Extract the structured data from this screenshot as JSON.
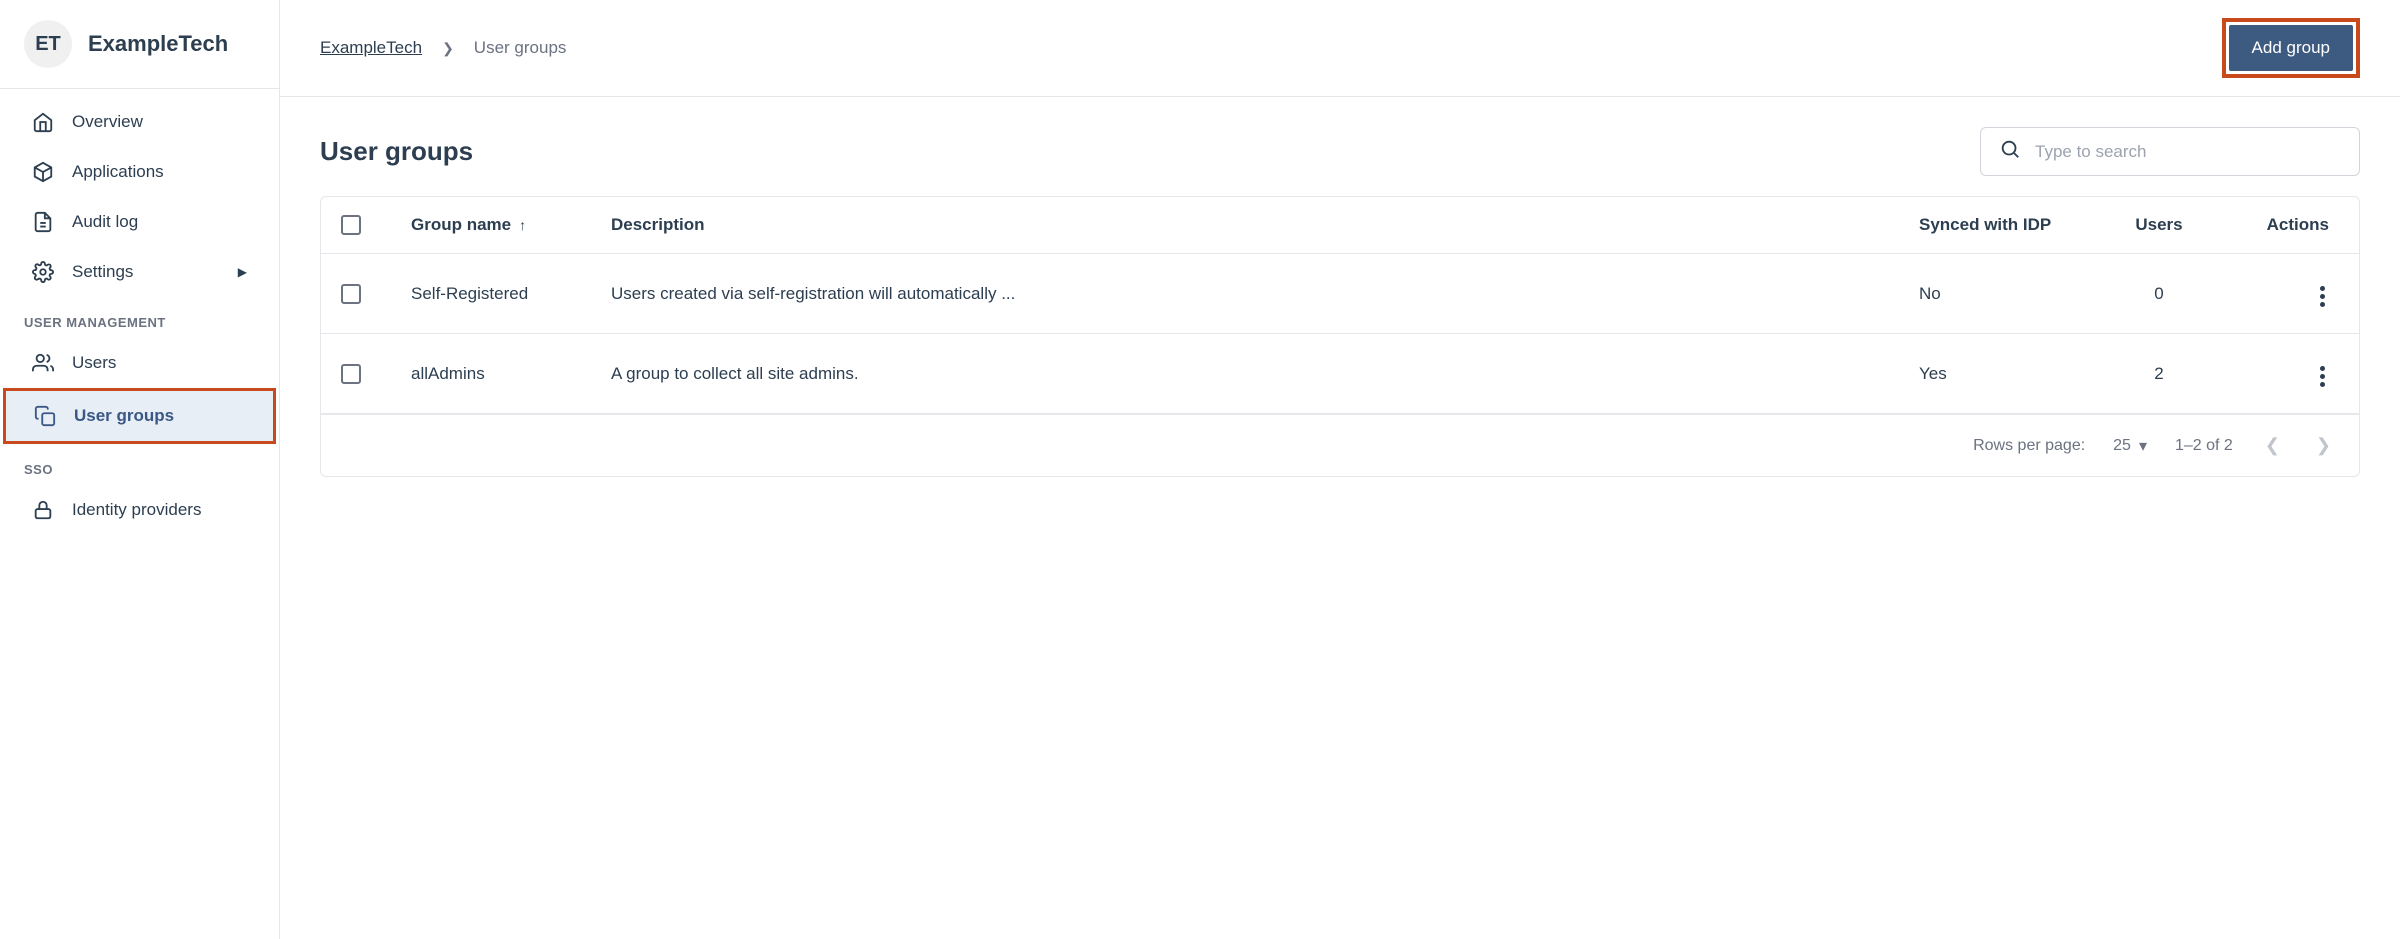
{
  "org": {
    "initials": "ET",
    "name": "ExampleTech"
  },
  "nav": {
    "overview": "Overview",
    "applications": "Applications",
    "auditlog": "Audit log",
    "settings": "Settings",
    "section_user": "USER MANAGEMENT",
    "users": "Users",
    "usergroups": "User groups",
    "section_sso": "SSO",
    "idp": "Identity providers"
  },
  "breadcrumb": {
    "root": "ExampleTech",
    "current": "User groups"
  },
  "actions": {
    "add_group": "Add group"
  },
  "page": {
    "title": "User groups",
    "search_placeholder": "Type to search"
  },
  "table": {
    "cols": {
      "name": "Group name",
      "desc": "Description",
      "idp": "Synced with IDP",
      "users": "Users",
      "actions": "Actions"
    },
    "rows": [
      {
        "name": "Self-Registered",
        "desc": "Users created via self-registration will automatically ...",
        "idp": "No",
        "users": "0"
      },
      {
        "name": "allAdmins",
        "desc": "A group to collect all site admins.",
        "idp": "Yes",
        "users": "2"
      }
    ]
  },
  "pagination": {
    "rows_label": "Rows per page:",
    "rows_value": "25",
    "range": "1–2 of 2"
  }
}
